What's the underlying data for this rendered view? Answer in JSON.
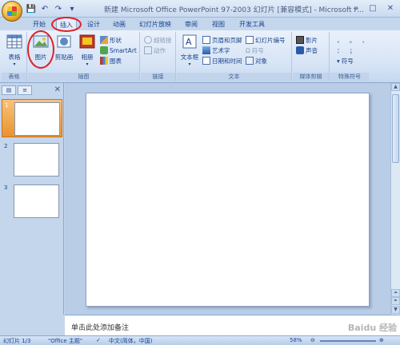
{
  "window": {
    "title": "新建 Microsoft Office PowerPoint 97-2003 幻灯片 [兼容模式] - Microsoft P...",
    "controls": [
      "–",
      "□",
      "✕"
    ]
  },
  "qat": {
    "save": "💾",
    "undo": "↶",
    "redo": "↷",
    "more": "▾"
  },
  "tabs": [
    {
      "label": "开始"
    },
    {
      "label": "插入"
    },
    {
      "label": "设计"
    },
    {
      "label": "动画"
    },
    {
      "label": "幻灯片放映"
    },
    {
      "label": "审阅"
    },
    {
      "label": "视图"
    },
    {
      "label": "开发工具"
    }
  ],
  "ribbon": {
    "tables_group": {
      "label": "表格",
      "table_btn": "表格"
    },
    "illustrations_group": {
      "label": "插图",
      "picture_btn": "图片",
      "clipart_btn": "剪贴画",
      "album_btn": "相册",
      "shapes": "形状",
      "smartart": "SmartArt",
      "chart": "图表"
    },
    "links_group": {
      "label": "链接",
      "hyperlink": "超链接",
      "action": "动作"
    },
    "text_group": {
      "label": "文本",
      "textbox_btn": "文本框",
      "header_footer": "页眉和页脚",
      "wordart": "艺术字",
      "datetime": "日期和时间",
      "slide_number": "幻灯片编号",
      "symbol": "符号",
      "object": "对象"
    },
    "media_group": {
      "label": "媒体剪辑",
      "movie": "影片",
      "sound": "声音"
    },
    "special_group": {
      "label": "特殊符号",
      "symbol": "符号"
    }
  },
  "slides_panel": {
    "close": "✕",
    "thumbs": [
      {
        "num": "1"
      },
      {
        "num": "2"
      },
      {
        "num": "3"
      }
    ]
  },
  "notes": {
    "placeholder": "单击此处添加备注"
  },
  "status": {
    "slide": "幻灯片 1/3",
    "theme": "\"Office 主题\"",
    "lang": "中文(简体，中国)",
    "zoom": "58%"
  },
  "watermark": "Baidu 经验",
  "highlight_color": "#e0202a"
}
